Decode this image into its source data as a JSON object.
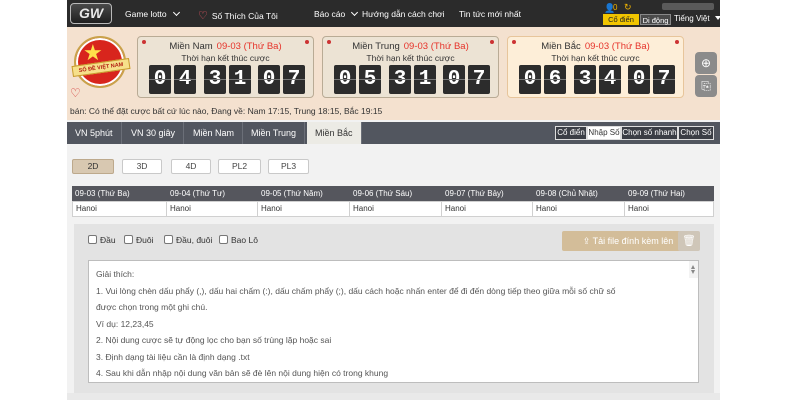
{
  "nav": {
    "logo": "GW",
    "items": [
      "Game lotto",
      "Số Thích Của Tôi",
      "Báo cáo",
      "Hướng dẫn cách chơi",
      "Tin tức mới nhất"
    ],
    "coins": "0",
    "btn_classic": "Cổ điển",
    "btn_mobile": "Di động",
    "language": "Tiếng Việt"
  },
  "banner": {
    "emblem_text": "SỔ ĐỀ VIỆT NAM",
    "marquee": "bán: Có thể đặt cược bất cứ lúc nào,   Đang về: Nam 17:15, Trung 18:15, Bắc 19:15",
    "cards": [
      {
        "region": "Miền Nam",
        "date": "09-03 (Thứ Ba)",
        "subtitle": "Thời hạn kết thúc cược",
        "digits": [
          "0",
          "4",
          "3",
          "1",
          "0",
          "7"
        ]
      },
      {
        "region": "Miền Trung",
        "date": "09-03 (Thứ Ba)",
        "subtitle": "Thời hạn kết thúc cược",
        "digits": [
          "0",
          "5",
          "3",
          "1",
          "0",
          "7"
        ]
      },
      {
        "region": "Miền Bắc",
        "date": "09-03 (Thứ Ba)",
        "subtitle": "Thời hạn kết thúc cược",
        "digits": [
          "0",
          "6",
          "3",
          "4",
          "0",
          "7"
        ]
      }
    ]
  },
  "region_tabs": [
    "VN 5phút",
    "VN 30 giây",
    "Miền Nam",
    "Miền Trung",
    "Miền Bắc"
  ],
  "modes": [
    "Cổ điển",
    "Nhập Số",
    "Chọn số nhanh",
    "Chọn Số"
  ],
  "sub_tabs": [
    "2D",
    "3D",
    "4D",
    "PL2",
    "PL3"
  ],
  "dates": {
    "headers": [
      "09-03 (Thứ Ba)",
      "09-04 (Thứ Tư)",
      "09-05 (Thứ Năm)",
      "09-06 (Thứ Sáu)",
      "09-07 (Thứ Bảy)",
      "09-08 (Chủ Nhật)",
      "09-09 (Thứ Hai)"
    ],
    "values": [
      "Hanoi",
      "Hanoi",
      "Hanoi",
      "Hanoi",
      "Hanoi",
      "Hanoi",
      "Hanoi"
    ]
  },
  "options": [
    "Đầu",
    "Đuôi",
    "Đầu, đuôi",
    "Bao Lô"
  ],
  "upload_label": "Tải file đính kèm lên",
  "instructions": [
    "Giải thích:",
    "1. Vui lòng chèn dấu phẩy (,), dấu hai chấm (:), dấu chấm phẩy (;), dấu cách hoặc nhấn enter để đi đến dòng tiếp theo giữa mỗi số chữ số",
    "được chọn trong một ghi chú.",
    "Ví dụ: 12,23,45",
    "2. Nội dung cược sẽ tự động lọc cho bạn số trùng lặp hoặc sai",
    "3. Định dạng tài liệu cần là định dạng .txt",
    "4. Sau khi dẫn nhập nội dung văn bản sẽ đè lên nội dung hiện có trong khung"
  ]
}
